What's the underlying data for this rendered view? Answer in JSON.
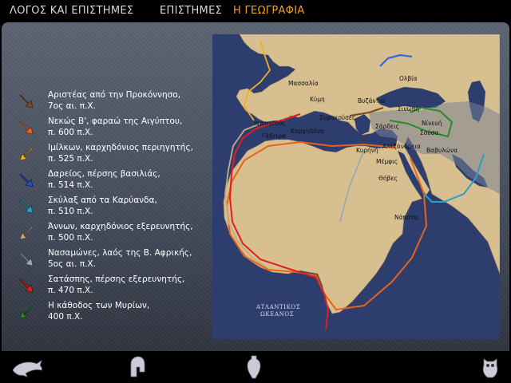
{
  "breadcrumb": {
    "items": [
      "ΛΟΓΟΣ ΚΑΙ ΕΠΙΣΤΗΜΕΣ",
      "ΕΠΙΣΤΗΜΕΣ",
      "Η ΓΕΩΓΡΑΦΙΑ"
    ],
    "active_color": "#f0a020"
  },
  "legend": [
    {
      "text": "Αριστέας από την Προκόννησο,\n7ος αι. π.Χ.",
      "color": "#7a4a22"
    },
    {
      "text": "Νεκώς Β', φαραώ της Αιγύπτου,\nπ. 600 π.Χ.",
      "color": "#e8621a"
    },
    {
      "text": "Ιμίλκων, καρχηδόνιος περιηγητής,\nπ. 525 π.Χ.",
      "color": "#f0b020"
    },
    {
      "text": "Δαρείος, πέρσης βασιλιάς,\nπ. 514 π.Χ.",
      "color": "#2a4cc8"
    },
    {
      "text": "Σκύλαξ από τα Καρύανδα,\nπ. 510 π.Χ.",
      "color": "#2aa0c8"
    },
    {
      "text": "Άννων, καρχηδόνιος εξερευνητής,\nπ. 500 π.Χ.",
      "color": "#c8aa80"
    },
    {
      "text": "Νασαμώνες, λαός της Β. Αφρικής,\n5ος αι. π.Χ.",
      "color": "#9aaab0"
    },
    {
      "text": "Σατάσπης, πέρσης εξερευνητής,\nπ. 470 π.Χ.",
      "color": "#e02020"
    },
    {
      "text": "Η κάθοδος των Μυρίων,\n400 π.Χ.",
      "color": "#2a8a2a"
    }
  ],
  "map": {
    "cities": [
      "Μασσαλία",
      "Κύμη",
      "Βυζάντιο",
      "Ολβία",
      "Σινώπη",
      "Ιαρτησσός",
      "Γάδειρα",
      "Καρχηδόνα",
      "Συρακούσες",
      "Σάρδεις",
      "Νίνευή",
      "Σούσα",
      "Κυρήνη",
      "Αλεξάνδρεια",
      "Βαβυλώνα",
      "Μέμφις",
      "Θήβες",
      "Νάπατα"
    ],
    "ocean_label": "ΑΤΛΑΝΤΙΚΟΣ\nΩΚΕΑΝΟΣ",
    "colors": {
      "sea": "#2c3d6e",
      "land": "#d8bf8f"
    }
  },
  "toolbar": {
    "icons": [
      "dolphin-icon",
      "helmet-icon",
      "amphora-icon",
      "owl-icon"
    ]
  }
}
